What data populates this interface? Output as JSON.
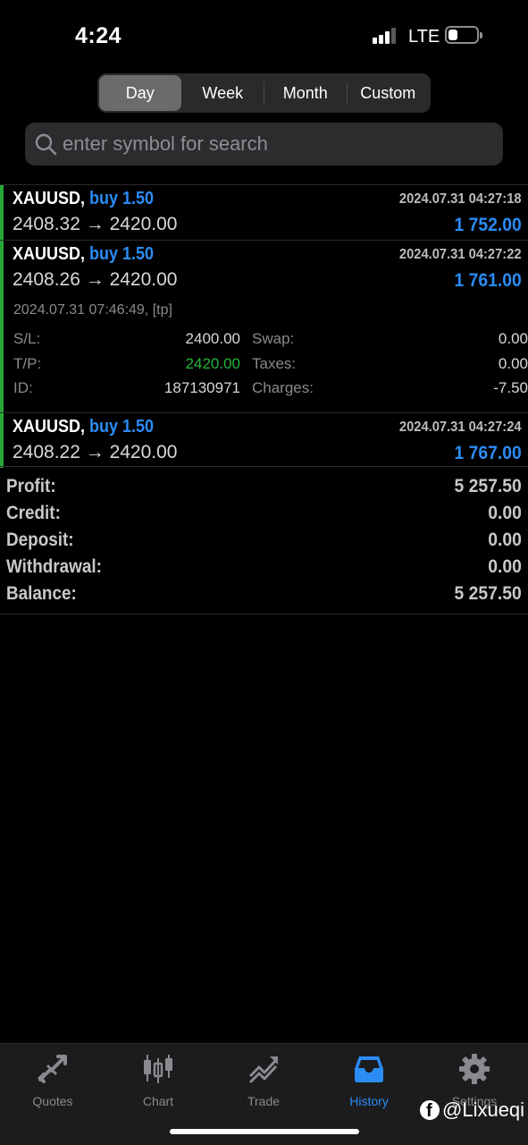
{
  "status_bar": {
    "time": "4:24",
    "network": "LTE"
  },
  "segments": [
    {
      "label": "Day",
      "active": true
    },
    {
      "label": "Week",
      "active": false
    },
    {
      "label": "Month",
      "active": false
    },
    {
      "label": "Custom",
      "active": false
    }
  ],
  "search": {
    "placeholder": "enter symbol for search",
    "value": ""
  },
  "deals": [
    {
      "symbol": "XAUUSD,",
      "side": "buy 1.50",
      "time": "2024.07.31 04:27:18",
      "prices": "2408.32 → 2420.00",
      "profit": "1 752.00"
    },
    {
      "symbol": "XAUUSD,",
      "side": "buy 1.50",
      "time": "2024.07.31 04:27:22",
      "prices": "2408.26 → 2420.00",
      "profit": "1 761.00",
      "details": {
        "close_info": "2024.07.31 07:46:49, [tp]",
        "sl_label": "S/L:",
        "sl_value": "2400.00",
        "swap_label": "Swap:",
        "swap_value": "0.00",
        "tp_label": "T/P:",
        "tp_value": "2420.00",
        "taxes_label": "Taxes:",
        "taxes_value": "0.00",
        "id_label": "ID:",
        "id_value": "187130971",
        "charges_label": "Charges:",
        "charges_value": "-7.50"
      }
    },
    {
      "symbol": "XAUUSD,",
      "side": "buy 1.50",
      "time": "2024.07.31 04:27:24",
      "prices": "2408.22 → 2420.00",
      "profit": "1 767.00"
    }
  ],
  "summary": [
    {
      "label": "Profit:",
      "value": "5 257.50"
    },
    {
      "label": "Credit:",
      "value": "0.00"
    },
    {
      "label": "Deposit:",
      "value": "0.00"
    },
    {
      "label": "Withdrawal:",
      "value": "0.00"
    },
    {
      "label": "Balance:",
      "value": "5 257.50"
    }
  ],
  "tabs": [
    {
      "label": "Quotes",
      "icon": "quotes-icon",
      "active": false
    },
    {
      "label": "Chart",
      "icon": "chart-icon",
      "active": false
    },
    {
      "label": "Trade",
      "icon": "trade-icon",
      "active": false
    },
    {
      "label": "History",
      "icon": "history-icon",
      "active": true
    },
    {
      "label": "Settings",
      "icon": "settings-icon",
      "active": false
    }
  ],
  "watermark": "@Lixueqi",
  "colors": {
    "accent": "#2b8cf6",
    "buy_bar": "#27a836",
    "tp_green": "#27b43a"
  }
}
